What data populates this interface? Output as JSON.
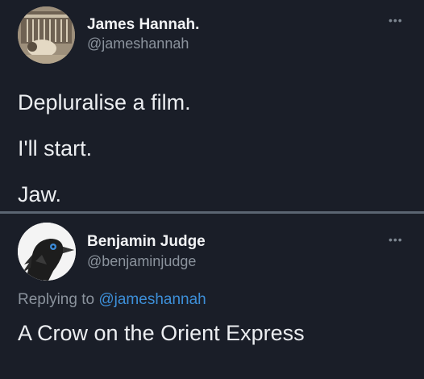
{
  "tweet": {
    "author_name": "James Hannah.",
    "author_handle": "@jameshannah",
    "more_icon": "more-horizontal-icon",
    "lines": [
      "Depluralise a film.",
      "I'll start.",
      "Jaw."
    ]
  },
  "reply": {
    "author_name": "Benjamin Judge",
    "author_handle": "@benjaminjudge",
    "more_icon": "more-horizontal-icon",
    "replying_prefix": "Replying to",
    "replying_to": "@jameshannah",
    "text": "A Crow on the Orient Express"
  },
  "colors": {
    "background": "#1a1e28",
    "mention": "#3d8fd8",
    "secondary_text": "#8b939d",
    "divider": "#5b6572"
  }
}
